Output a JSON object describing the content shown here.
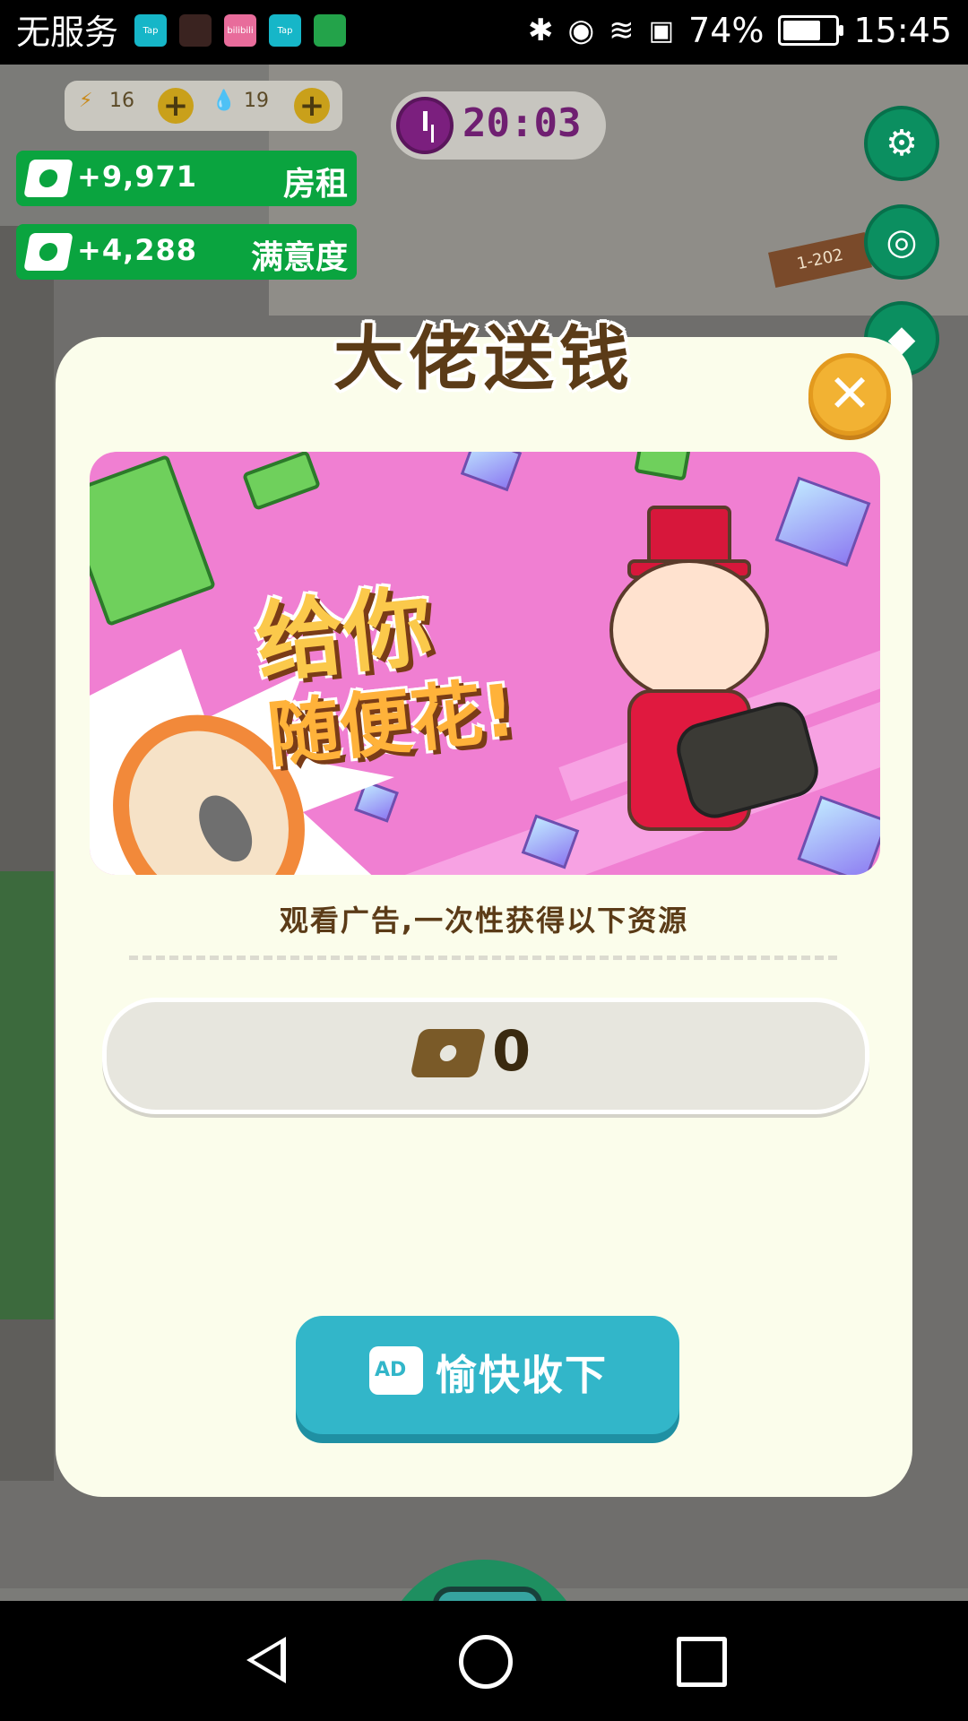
{
  "status_bar": {
    "carrier": "无服务",
    "apps": [
      {
        "name": "Tap",
        "color": "#16b6c8"
      },
      {
        "name": "",
        "color": "#3a2320"
      },
      {
        "name": "bilibili",
        "color": "#e86c9b"
      },
      {
        "name": "Tap",
        "color": "#16b6c8"
      },
      {
        "name": "",
        "color": "#23a34a"
      }
    ],
    "battery_percent": "74%",
    "battery_level": 0.74,
    "time": "15:45"
  },
  "hud": {
    "energy": "16",
    "water": "19",
    "timer": "20:03",
    "rent_value": "+9,971",
    "rent_label": "房租",
    "satisfaction_value": "+4,288",
    "satisfaction_label": "满意度",
    "room_number": "1-202"
  },
  "dialog": {
    "title": "大佬送钱",
    "close_label": "✕",
    "banner_line1": "给你",
    "banner_line2": "随便花!",
    "subtitle": "观看广告,一次性获得以下资源",
    "reward_value": "0",
    "accept_ad_label": "AD",
    "accept_label": "愉快收下"
  },
  "colors": {
    "accent_teal": "#32b6c9",
    "hud_green": "#0aa43f",
    "close_orange": "#f2b233",
    "title_brown": "#5b3b17"
  }
}
